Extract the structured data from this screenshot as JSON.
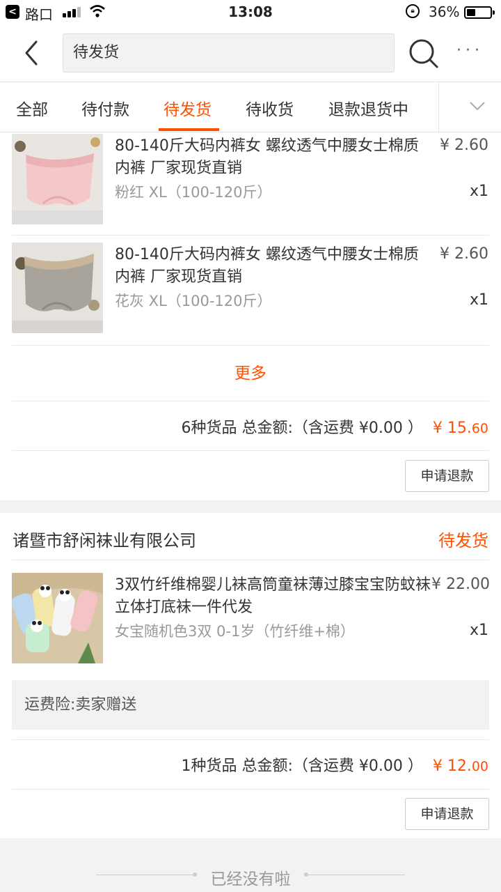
{
  "status_bar": {
    "back_glyph": "<",
    "carrier": "路口",
    "time": "13:08",
    "battery_percent": "36%",
    "battery_level": 0.36
  },
  "nav": {
    "search_value": "待发货"
  },
  "tabs": [
    {
      "label": "全部",
      "active": false
    },
    {
      "label": "待付款",
      "active": false
    },
    {
      "label": "待发货",
      "active": true
    },
    {
      "label": "待收货",
      "active": false
    },
    {
      "label": "退款退货中",
      "active": false
    }
  ],
  "order1": {
    "items": [
      {
        "title": "80-140斤大码内裤女 螺纹透气中腰女士棉质内裤 厂家现货直销",
        "price": "¥ 2.60",
        "sku": "粉红 XL（100-120斤）",
        "qty": "x1"
      },
      {
        "title": "80-140斤大码内裤女 螺纹透气中腰女士棉质内裤 厂家现货直销",
        "price": "¥ 2.60",
        "sku": "花灰 XL（100-120斤）",
        "qty": "x1"
      }
    ],
    "more_label": "更多",
    "summary_text": "6种货品 总金额:（含运费 ¥0.00 ）",
    "total_main": "¥ 15.",
    "total_cents": "60",
    "refund_label": "申请退款"
  },
  "order2": {
    "shop_name": "诸暨市舒闲袜业有限公司",
    "status": "待发货",
    "items": [
      {
        "title": "3双竹纤维棉婴儿袜高筒童袜薄过膝宝宝防蚊袜立体打底袜一件代发",
        "price": "¥ 22.00",
        "sku": "女宝随机色3双 0-1岁（竹纤维+棉）",
        "qty": "x1"
      }
    ],
    "insurance": "运费险:卖家赠送",
    "summary_text": "1种货品 总金额:（含运费 ¥0.00 ）",
    "total_main": "¥ 12.",
    "total_cents": "00",
    "refund_label": "申请退款"
  },
  "end_text": "已经没有啦",
  "colors": {
    "accent": "#ff5000",
    "background": "#f2f2f2",
    "muted_text": "#999999"
  },
  "icons": [
    "back-arrow-icon",
    "search-icon",
    "more-icon",
    "chevron-down-icon",
    "signal-icon",
    "wifi-icon",
    "orientation-lock-icon",
    "battery-icon"
  ]
}
